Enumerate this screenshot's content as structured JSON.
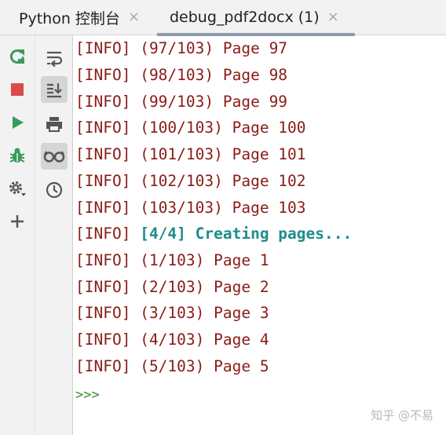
{
  "tabs": [
    {
      "label": "Python 控制台",
      "close": "×"
    },
    {
      "label": "debug_pdf2docx (1)",
      "close": "×"
    }
  ],
  "toolbar_left": [
    {
      "name": "rerun-icon"
    },
    {
      "name": "stop-icon"
    },
    {
      "name": "run-icon"
    },
    {
      "name": "debug-icon"
    },
    {
      "name": "settings-icon"
    },
    {
      "name": "add-icon"
    }
  ],
  "toolbar_right": [
    {
      "name": "soft-wrap-icon"
    },
    {
      "name": "scroll-to-end-icon"
    },
    {
      "name": "print-icon"
    },
    {
      "name": "show-variables-icon"
    },
    {
      "name": "history-icon"
    }
  ],
  "console": {
    "lines": [
      {
        "tag": "[INFO]",
        "msg": "(97/103) Page 97",
        "bold": false
      },
      {
        "tag": "[INFO]",
        "msg": "(98/103) Page 98",
        "bold": false
      },
      {
        "tag": "[INFO]",
        "msg": "(99/103) Page 99",
        "bold": false
      },
      {
        "tag": "[INFO]",
        "msg": "(100/103) Page 100",
        "bold": false
      },
      {
        "tag": "[INFO]",
        "msg": "(101/103) Page 101",
        "bold": false
      },
      {
        "tag": "[INFO]",
        "msg": "(102/103) Page 102",
        "bold": false
      },
      {
        "tag": "[INFO]",
        "msg": "(103/103) Page 103",
        "bold": false
      },
      {
        "tag": "[INFO]",
        "msg": "[4/4] Creating pages...",
        "bold": true
      },
      {
        "tag": "[INFO]",
        "msg": "(1/103) Page 1",
        "bold": false
      },
      {
        "tag": "[INFO]",
        "msg": "(2/103) Page 2",
        "bold": false
      },
      {
        "tag": "[INFO]",
        "msg": "(3/103) Page 3",
        "bold": false
      },
      {
        "tag": "[INFO]",
        "msg": "(4/103) Page 4",
        "bold": false
      },
      {
        "tag": "[INFO]",
        "msg": "(5/103) Page 5",
        "bold": false
      }
    ],
    "prompt": ">>>"
  },
  "watermark": "知乎 @不易",
  "colors": {
    "log_text": "#8a1b17",
    "highlight_text": "#1f8c8c",
    "prompt": "#2e8b2e",
    "rerun": "#3a9b5c",
    "stop": "#db4b4b",
    "run": "#3a9b5c",
    "debug": "#3a9b5c",
    "toolbar_icon": "#555555"
  }
}
